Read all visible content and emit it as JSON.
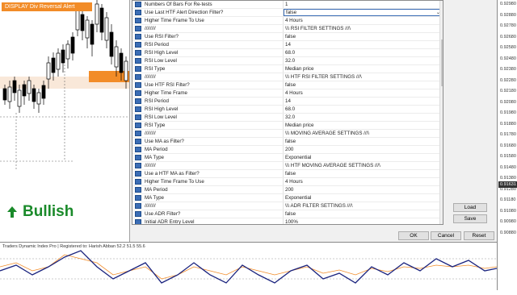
{
  "chart": {
    "alert_label": "DISPLAY Div Reversal Alert",
    "signal_label": "Bullish",
    "signal_color": "#1a8a2a",
    "alert_color": "#f28c28"
  },
  "dialog": {
    "rows": [
      {
        "name": "Numbers Of Bars For Re-tests",
        "value": "1"
      },
      {
        "name": "Use Last HTF Alert Direction Filter?",
        "value": "false"
      },
      {
        "name": "Higher Time Frame To Use",
        "value": "4 Hours"
      },
      {
        "name": "////////",
        "value": "\\\\\\ RSI FILTER SETTINGS ///\\"
      },
      {
        "name": "Use RSI Filter?",
        "value": "false"
      },
      {
        "name": "RSI Period",
        "value": "14"
      },
      {
        "name": "RSI High Level",
        "value": "68.0"
      },
      {
        "name": "RSI Low Level",
        "value": "32.0"
      },
      {
        "name": "RSI Type",
        "value": "Median price"
      },
      {
        "name": "////////",
        "value": "\\\\\\ HTF RSI FILTER SETTINGS ///\\"
      },
      {
        "name": "Use HTF RSI Filter?",
        "value": "false"
      },
      {
        "name": "Higher Time Frame",
        "value": "4 Hours"
      },
      {
        "name": "RSI Period",
        "value": "14"
      },
      {
        "name": "RSI High Level",
        "value": "68.0"
      },
      {
        "name": "RSI Low Level",
        "value": "32.0"
      },
      {
        "name": "RSI Type",
        "value": "Median price"
      },
      {
        "name": "////////",
        "value": "\\\\\\ MOVING AVERAGE SETTINGS ///\\"
      },
      {
        "name": "Use MA as Filter?",
        "value": "false"
      },
      {
        "name": "MA Period",
        "value": "200"
      },
      {
        "name": "MA Type",
        "value": "Exponential"
      },
      {
        "name": "////////",
        "value": "\\\\\\ HTF MOVING AVERAGE SETTINGS ///\\"
      },
      {
        "name": "Use a HTF MA as Filter?",
        "value": "false"
      },
      {
        "name": "Higher Time Frame To Use",
        "value": "4 Hours"
      },
      {
        "name": "MA Period",
        "value": "200"
      },
      {
        "name": "MA Type",
        "value": "Exponential"
      },
      {
        "name": "////////",
        "value": "\\\\\\ ADR FILTER SETTINGS ///\\"
      },
      {
        "name": "Use ADR Filter?",
        "value": "false"
      },
      {
        "name": "Initial ADR Entry Level",
        "value": "100%"
      }
    ],
    "buttons": {
      "load": "Load",
      "save": "Save",
      "ok": "OK",
      "cancel": "Cancel",
      "reset": "Reset"
    }
  },
  "price_axis": {
    "ticks": [
      "0.92980",
      "0.92880",
      "0.92780",
      "0.92680",
      "0.92580",
      "0.92480",
      "0.92380",
      "0.92280",
      "0.92180",
      "0.92080",
      "0.91980",
      "0.91880",
      "0.91780",
      "0.91680",
      "0.91580",
      "0.91480",
      "0.91380",
      "0.91280",
      "0.91180",
      "0.91080",
      "0.90980",
      "0.90880"
    ],
    "current": "0.91631"
  },
  "sub_window": {
    "title": "Traders Dynamic Index Pro | Registered to: Harish Abban 52.2 51.5 55.6"
  }
}
